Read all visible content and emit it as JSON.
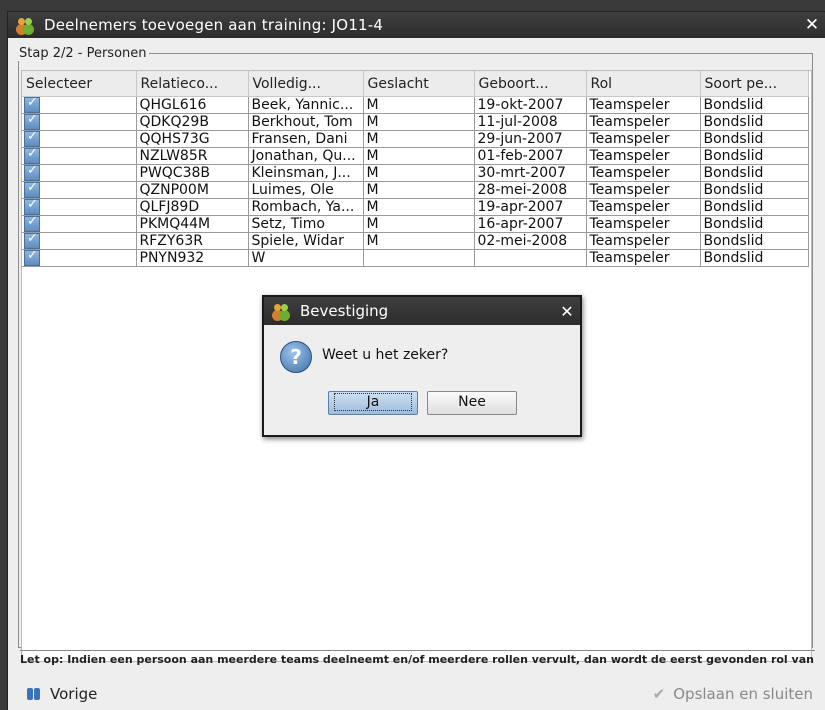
{
  "window": {
    "title": "Deelnemers toevoegen aan training: JO11-4",
    "close_label": "✕"
  },
  "group": {
    "legend": "Stap 2/2 - Personen"
  },
  "table": {
    "headers": [
      "Selecteer",
      "Relatieco...",
      "Volledig...",
      "Geslacht",
      "Geboort...",
      "Rol",
      "Soort pe..."
    ],
    "rows": [
      {
        "code": "QHGL616",
        "name": "Beek, Yannic...",
        "gender": "M",
        "birth": "19-okt-2007",
        "role": "Teamspeler",
        "type": "Bondslid"
      },
      {
        "code": "QDKQ29B",
        "name": "Berkhout, Tom",
        "gender": "M",
        "birth": "11-jul-2008",
        "role": "Teamspeler",
        "type": "Bondslid"
      },
      {
        "code": "QQHS73G",
        "name": "Fransen, Dani",
        "gender": "M",
        "birth": "29-jun-2007",
        "role": "Teamspeler",
        "type": "Bondslid"
      },
      {
        "code": "NZLW85R",
        "name": "Jonathan, Qu...",
        "gender": "M",
        "birth": "01-feb-2007",
        "role": "Teamspeler",
        "type": "Bondslid"
      },
      {
        "code": "PWQC38B",
        "name": "Kleinsman, J...",
        "gender": "M",
        "birth": "30-mrt-2007",
        "role": "Teamspeler",
        "type": "Bondslid"
      },
      {
        "code": "QZNP00M",
        "name": "Luimes, Ole",
        "gender": "M",
        "birth": "28-mei-2008",
        "role": "Teamspeler",
        "type": "Bondslid"
      },
      {
        "code": "QLFJ89D",
        "name": "Rombach, Ya...",
        "gender": "M",
        "birth": "19-apr-2007",
        "role": "Teamspeler",
        "type": "Bondslid"
      },
      {
        "code": "PKMQ44M",
        "name": "Setz, Timo",
        "gender": "M",
        "birth": "16-apr-2007",
        "role": "Teamspeler",
        "type": "Bondslid"
      },
      {
        "code": "RFZY63R",
        "name": "Spiele, Widar",
        "gender": "M",
        "birth": "02-mei-2008",
        "role": "Teamspeler",
        "type": "Bondslid"
      },
      {
        "code": "PNYN932",
        "name": "W",
        "gender": "",
        "birth": "",
        "role": "Teamspeler",
        "type": "Bondslid"
      }
    ]
  },
  "notice": "Let op: Indien een persoon aan meerdere teams deelneemt en/of meerdere rollen vervult, dan wordt de eerst gevonden rol van",
  "footer": {
    "back_label": "Vorige",
    "save_label": "Opslaan en sluiten"
  },
  "dialog": {
    "title": "Bevestiging",
    "close_label": "✕",
    "message": "Weet u het zeker?",
    "yes_label": "Ja",
    "no_label": "Nee"
  },
  "colors": {
    "titlebar": "#333333",
    "accent": "#5d8cc0"
  }
}
